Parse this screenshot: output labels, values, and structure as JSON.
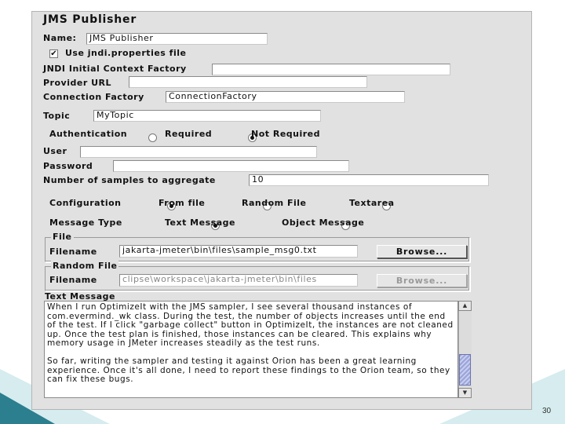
{
  "panel": {
    "title": "JMS Publisher",
    "name_label": "Name:",
    "name_value": "JMS Publisher",
    "use_jndi_label": "Use jndi.properties file",
    "use_jndi_checked": true,
    "jndi_factory_label": "JNDI Initial Context Factory",
    "jndi_factory_value": "",
    "provider_url_label": "Provider URL",
    "provider_url_value": "",
    "connection_factory_label": "Connection Factory",
    "connection_factory_value": "ConnectionFactory",
    "topic_label": "Topic",
    "topic_value": "MyTopic",
    "authentication_label": "Authentication",
    "auth_required_label": "Required",
    "auth_not_required_label": "Not Required",
    "auth_selected": "Not Required",
    "user_label": "User",
    "user_value": "",
    "password_label": "Password",
    "password_value": "",
    "samples_label": "Number of samples to aggregate",
    "samples_value": "10",
    "configuration_label": "Configuration",
    "config_from_file": "From file",
    "config_random_file": "Random File",
    "config_textarea": "Textarea",
    "config_selected": "From file",
    "message_type_label": "Message Type",
    "msg_text": "Text Message",
    "msg_object": "Object Message",
    "msg_selected": "Text Message",
    "file_group": {
      "legend": "File",
      "filename_label": "Filename",
      "filename_value": "jakarta-jmeter\\bin\\files\\sample_msg0.txt",
      "browse_label": "Browse..."
    },
    "random_group": {
      "legend": "Random File",
      "filename_label": "Filename",
      "filename_value": "clipse\\workspace\\jakarta-jmeter\\bin\\files",
      "browse_label": "Browse..."
    },
    "text_message_label": "Text Message",
    "text_message_paragraphs": [
      "When I run OptimizeIt with the JMS sampler, I see several thousand instances of com.evermind._wk class. During the test, the number of objects increases until the end of the test. If I click \"garbage collect\" button in OptimizeIt, the instances are not cleaned up. Once the test plan is finished, those instances can be cleared. This explains why memory usage in JMeter increases steadily as the test runs.",
      "So far, writing the sampler and testing it against Orion has been a great learning experience. Once it's all done, I need to report these findings to the Orion team, so they can fix these bugs."
    ]
  },
  "slide": {
    "page_number": "30",
    "accent_color": "#2b7f8e"
  }
}
